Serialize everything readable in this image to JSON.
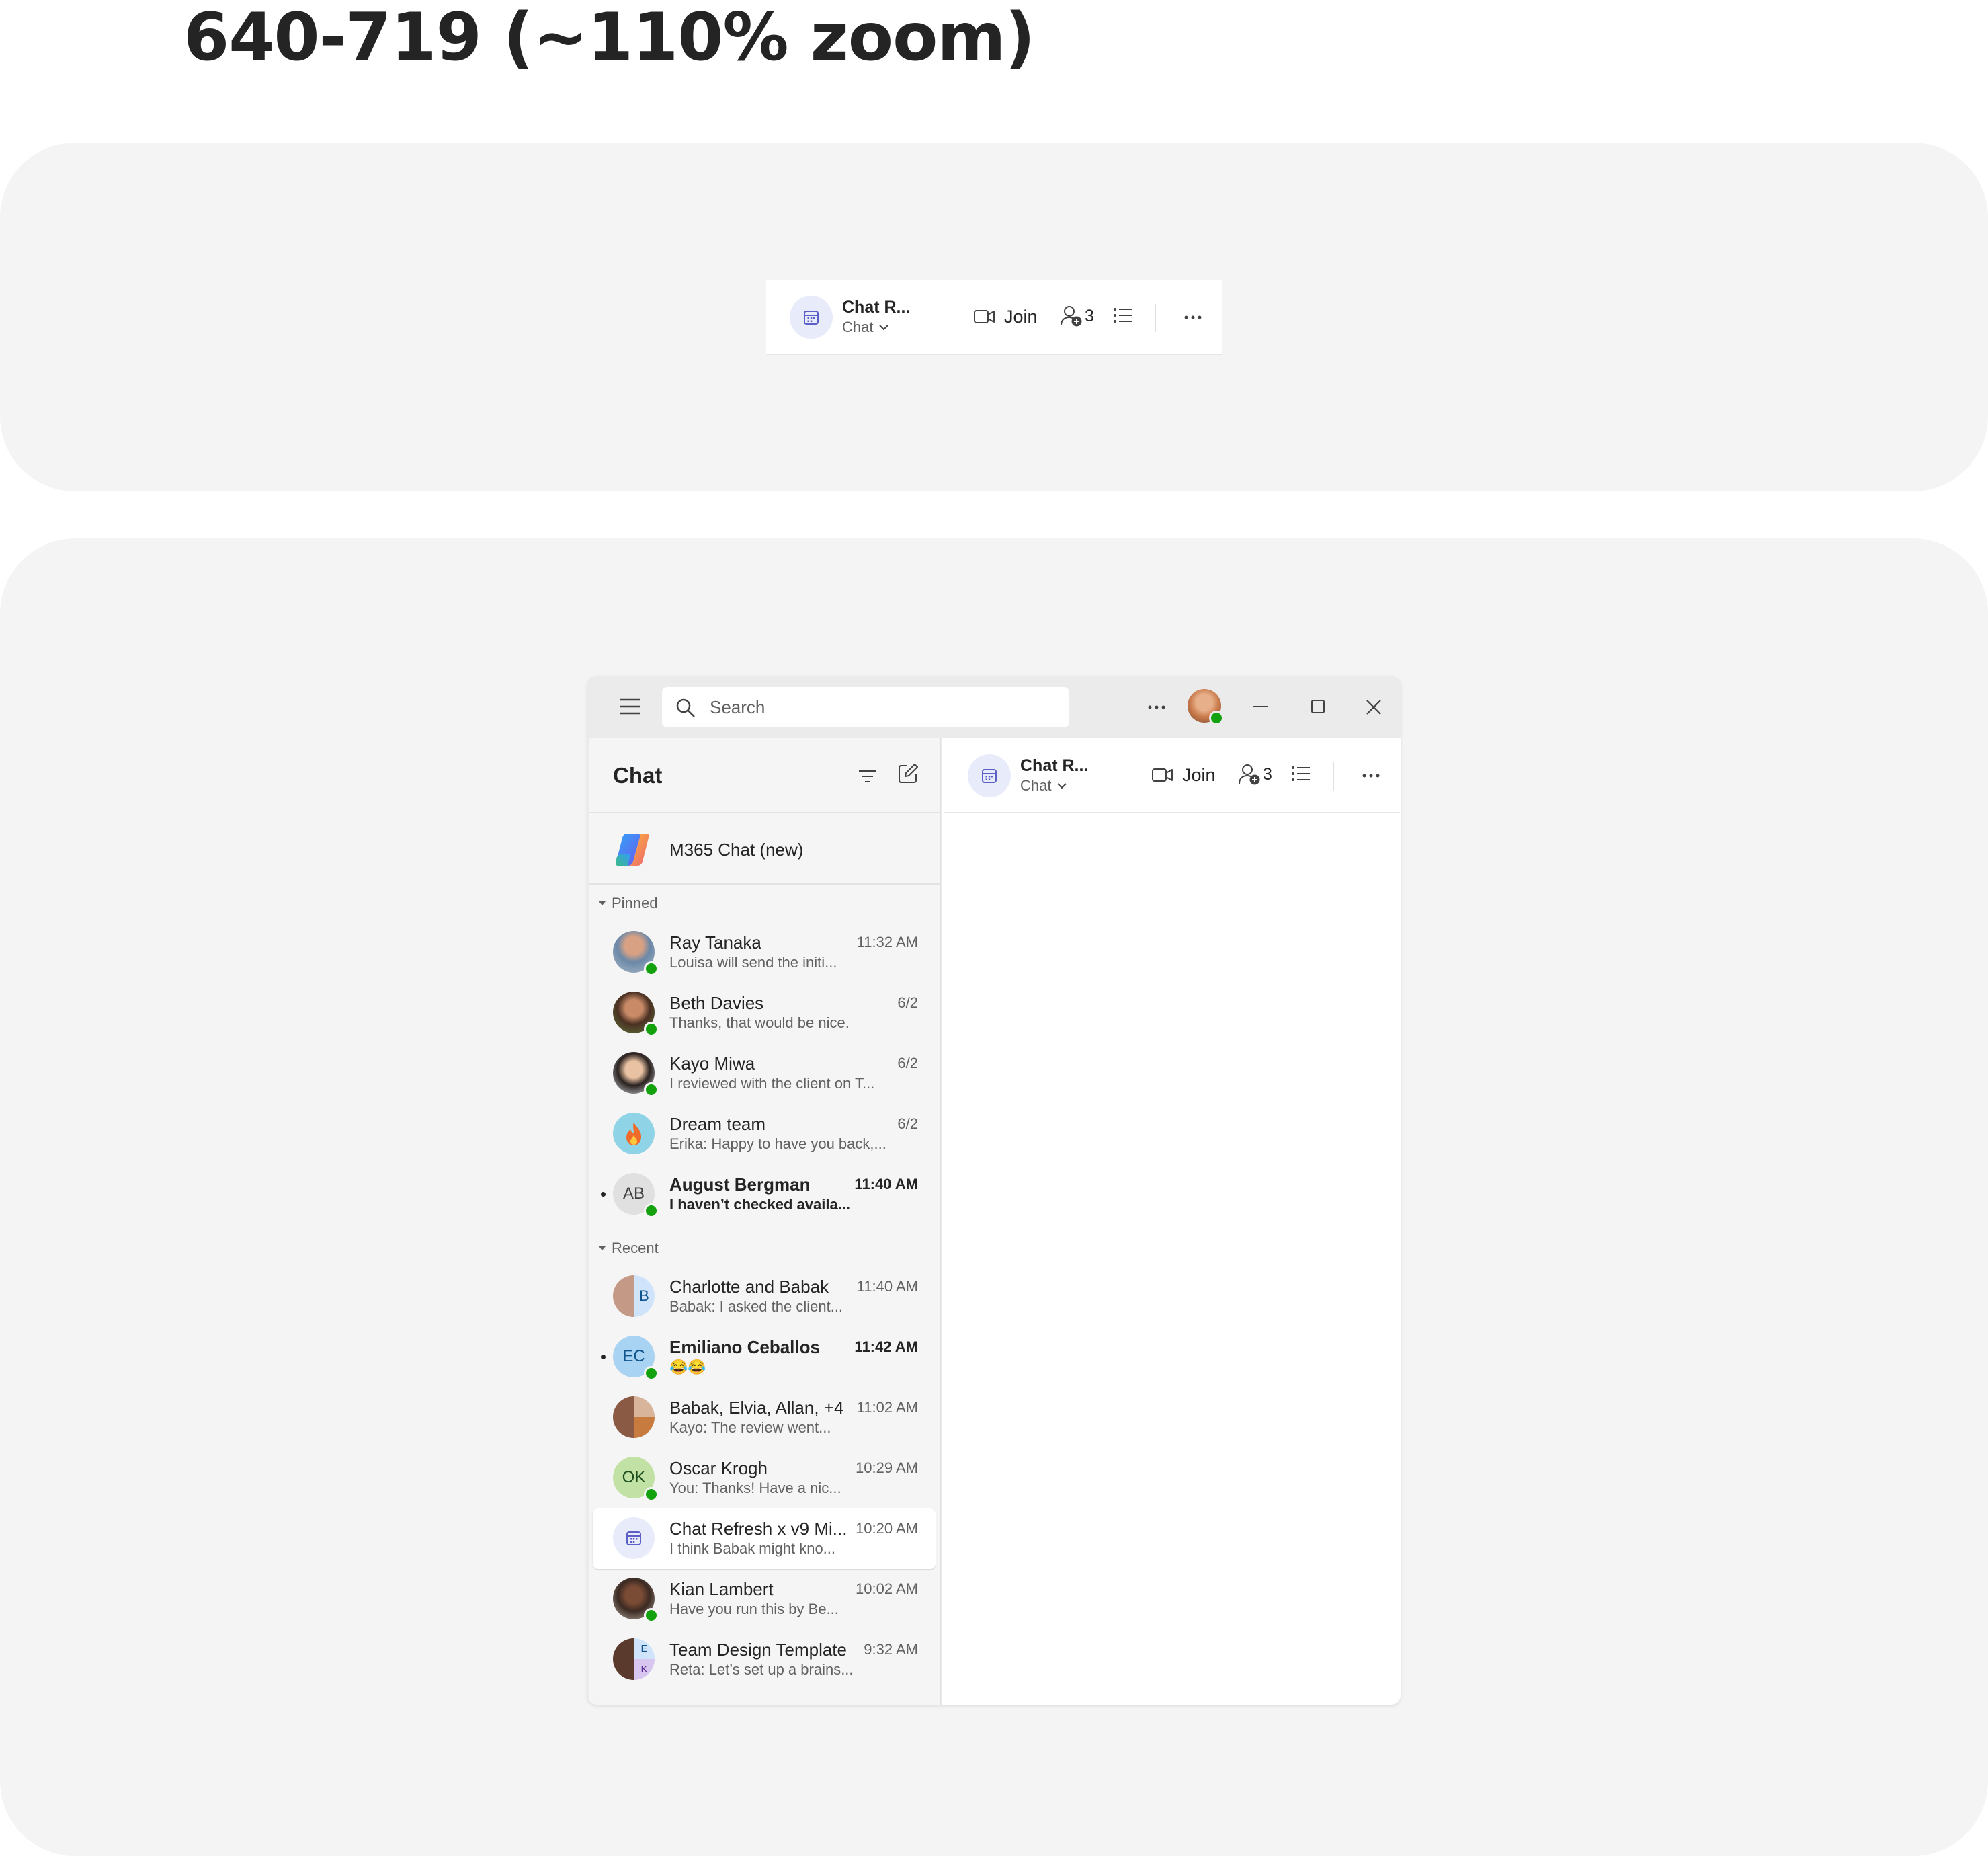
{
  "page": {
    "title": "640-719 (~110% zoom)"
  },
  "command_bar": {
    "title": "Chat R...",
    "subtitle": "Chat",
    "join_label": "Join",
    "participants_count": "3",
    "icons": [
      "calendar-icon",
      "chevron-down-icon",
      "video-camera-icon",
      "people-add-icon",
      "list-icon",
      "more-icon"
    ]
  },
  "titlebar": {
    "search_placeholder": "Search",
    "icons": [
      "hamburger-icon",
      "search-icon",
      "more-icon",
      "avatar",
      "minimize-icon",
      "maximize-icon",
      "close-icon"
    ]
  },
  "sidebar": {
    "title": "Chat",
    "m365_label": "M365 Chat (new)",
    "sections": {
      "pinned": "Pinned",
      "recent": "Recent"
    },
    "pinned": [
      {
        "name": "Ray Tanaka",
        "preview": "Louisa will send the initi...",
        "time": "11:32 AM"
      },
      {
        "name": "Beth Davies",
        "preview": "Thanks, that would be nice.",
        "time": "6/2"
      },
      {
        "name": "Kayo Miwa",
        "preview": "I reviewed with the client on T...",
        "time": "6/2"
      },
      {
        "name": "Dream team",
        "preview": "Erika: Happy to have you back,...",
        "time": "6/2"
      },
      {
        "name": "August Bergman",
        "initials": "AB",
        "preview": "I haven’t checked availa...",
        "time": "11:40 AM"
      }
    ],
    "recent": [
      {
        "name": "Charlotte and Babak",
        "initials": "B",
        "preview": "Babak: I asked the client...",
        "time": "11:40 AM"
      },
      {
        "name": "Emiliano Ceballos",
        "initials": "EC",
        "preview": "😂😂",
        "time": "11:42 AM"
      },
      {
        "name": "Babak, Elvia, Allan, +4",
        "preview": "Kayo: The review went...",
        "time": "11:02 AM"
      },
      {
        "name": "Oscar Krogh",
        "initials": "OK",
        "preview": "You: Thanks! Have a nic...",
        "time": "10:29 AM"
      },
      {
        "name": "Chat Refresh x v9 Mi...",
        "preview": "I think Babak might kno...",
        "time": "10:20 AM"
      },
      {
        "name": "Kian Lambert",
        "preview": "Have you run this by Be...",
        "time": "10:02 AM"
      },
      {
        "name": "Team Design Template",
        "initials_tr": "E",
        "initials_br": "K",
        "preview": "Reta: Let’s set up a brains...",
        "time": "9:32 AM"
      }
    ]
  },
  "colors": {
    "presence_available": "#13a10e",
    "brand": "#5b5fc7",
    "panel_bg": "#f4f4f4"
  }
}
